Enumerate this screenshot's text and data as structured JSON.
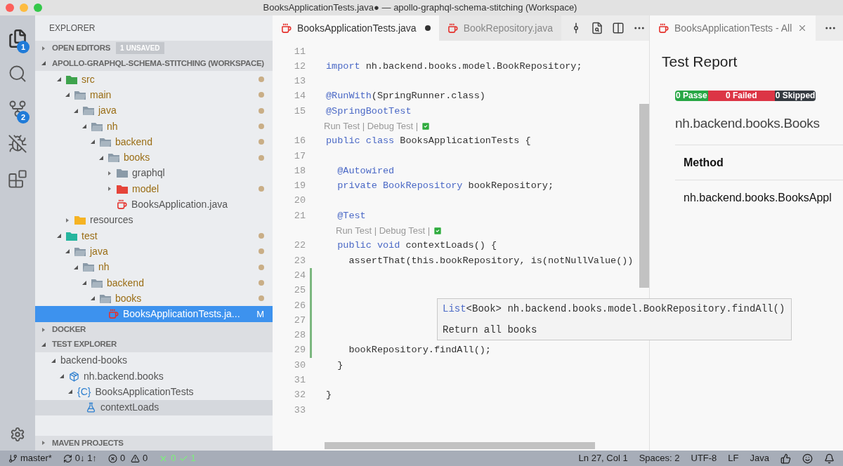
{
  "window": {
    "title": "BooksApplicationTests.java● — apollo-graphql-schema-stitching (Workspace)"
  },
  "activity_bar": {
    "items": [
      {
        "kind": "files",
        "selected": true,
        "badge": "1"
      },
      {
        "kind": "search",
        "selected": false
      },
      {
        "kind": "source-control",
        "selected": false,
        "badge": "2"
      },
      {
        "kind": "debug",
        "selected": false
      },
      {
        "kind": "extensions",
        "selected": false
      }
    ],
    "bottom": {
      "kind": "settings"
    }
  },
  "sidebar": {
    "title": "EXPLORER",
    "open_editors": {
      "label": "OPEN EDITORS",
      "expanded": false,
      "badge": "1 UNSAVED"
    },
    "workspace": {
      "label": "APOLLO-GRAPHQL-SCHEMA-STITCHING (WORKSPACE)",
      "expanded": true,
      "tree": [
        {
          "label": "src",
          "kind": "src-folder",
          "expanded": true,
          "modified": true,
          "children": [
            {
              "label": "main",
              "kind": "folder",
              "expanded": true,
              "modified": true,
              "children": [
                {
                  "label": "java",
                  "kind": "folder",
                  "expanded": true,
                  "modified": true,
                  "children": [
                    {
                      "label": "nh",
                      "kind": "folder",
                      "expanded": true,
                      "modified": true,
                      "children": [
                        {
                          "label": "backend",
                          "kind": "folder",
                          "expanded": true,
                          "modified": true,
                          "children": [
                            {
                              "label": "books",
                              "kind": "folder",
                              "expanded": true,
                              "modified": true,
                              "children": [
                                {
                                  "label": "graphql",
                                  "kind": "folder-closed",
                                  "expanded": false,
                                  "modified": false
                                },
                                {
                                  "label": "model",
                                  "kind": "model-folder",
                                  "expanded": false,
                                  "modified": true
                                },
                                {
                                  "label": "BooksApplication.java",
                                  "kind": "java-file",
                                  "modified": false,
                                  "selected": false
                                }
                              ]
                            }
                          ]
                        }
                      ]
                    }
                  ]
                }
              ]
            },
            {
              "label": "resources",
              "kind": "resources-folder",
              "expanded": false,
              "modified": false
            }
          ]
        },
        {
          "label": "test",
          "kind": "test-folder",
          "expanded": true,
          "modified": true,
          "children": [
            {
              "label": "java",
              "kind": "folder",
              "expanded": true,
              "modified": true,
              "children": [
                {
                  "label": "nh",
                  "kind": "folder",
                  "expanded": true,
                  "modified": true,
                  "children": [
                    {
                      "label": "backend",
                      "kind": "folder",
                      "expanded": true,
                      "modified": true,
                      "children": [
                        {
                          "label": "books",
                          "kind": "folder",
                          "expanded": true,
                          "modified": true,
                          "children": [
                            {
                              "label": "BooksApplicationTests.ja...",
                              "kind": "java-file",
                              "modified": false,
                              "selected": true,
                              "badge": "M"
                            }
                          ]
                        }
                      ]
                    }
                  ]
                }
              ]
            }
          ]
        }
      ]
    },
    "docker": {
      "label": "DOCKER",
      "expanded": false
    },
    "test_explorer": {
      "label": "TEST EXPLORER",
      "expanded": true,
      "tree": [
        {
          "label": "backend-books",
          "kind": "project",
          "expanded": true,
          "selected": false,
          "children": [
            {
              "label": "nh.backend.books",
              "kind": "package",
              "expanded": true,
              "selected": false,
              "children": [
                {
                  "label": "BooksApplicationTests",
                  "kind": "class",
                  "icon_text": "{C}",
                  "expanded": true,
                  "selected": false,
                  "children": [
                    {
                      "label": "contextLoads",
                      "kind": "method",
                      "selected": true
                    }
                  ]
                }
              ]
            }
          ]
        }
      ]
    },
    "maven": {
      "label": "MAVEN PROJECTS",
      "expanded": false
    }
  },
  "editor": {
    "tabs": [
      {
        "label": "BooksApplicationTests.java",
        "selected": true,
        "dirty": true
      },
      {
        "label": "BookRepository.java",
        "selected": false,
        "dirty": false
      }
    ],
    "actions": [
      {
        "kind": "compare"
      },
      {
        "kind": "find"
      },
      {
        "kind": "split"
      },
      {
        "kind": "more"
      }
    ],
    "lines": [
      {
        "number": "11"
      },
      {
        "number": "12",
        "tokens": [
          {
            "kind": "keyword",
            "text": "import"
          },
          {
            "kind": "plain",
            "text": " nh.backend.books.model.BookRepository;"
          }
        ]
      },
      {
        "number": "13"
      },
      {
        "number": "14",
        "tokens": [
          {
            "kind": "annotation",
            "text": "@RunWith"
          },
          {
            "kind": "plain",
            "text": "(SpringRunner.class)"
          }
        ]
      },
      {
        "number": "15",
        "tokens": [
          {
            "kind": "annotation",
            "text": "@SpringBootTest"
          }
        ]
      },
      {
        "kind": "codelens",
        "text": "Run Test | Debug Test |",
        "nested": false
      },
      {
        "number": "16",
        "tokens": [
          {
            "kind": "keyword",
            "text": "public class"
          },
          {
            "kind": "plain",
            "text": " BooksApplicationTests {"
          }
        ]
      },
      {
        "number": "17"
      },
      {
        "number": "18",
        "tokens": [
          {
            "kind": "annotation",
            "text": "  @Autowired"
          }
        ]
      },
      {
        "number": "19",
        "tokens": [
          {
            "kind": "keyword",
            "text": "  private"
          },
          {
            "kind": "type",
            "text": " BookRepository"
          },
          {
            "kind": "plain",
            "text": " bookRepository;"
          }
        ]
      },
      {
        "number": "20"
      },
      {
        "number": "21",
        "tokens": [
          {
            "kind": "annotation",
            "text": "  @Test"
          }
        ]
      },
      {
        "kind": "codelens",
        "text": "Run Test | Debug Test |",
        "nested": true
      },
      {
        "number": "22",
        "tokens": [
          {
            "kind": "keyword",
            "text": "  public void"
          },
          {
            "kind": "plain",
            "text": " contextLoads() {"
          }
        ]
      },
      {
        "number": "23",
        "tokens": [
          {
            "kind": "plain",
            "text": "    assertThat(this.bookRepository, is(notNullValue())"
          }
        ]
      },
      {
        "number": "24",
        "changed": true
      },
      {
        "number": "25",
        "changed": true
      },
      {
        "number": "26",
        "changed": true
      },
      {
        "number": "27",
        "changed": true
      },
      {
        "number": "28",
        "changed": true
      },
      {
        "number": "29",
        "tokens": [
          {
            "kind": "plain",
            "text": "    bookRepository.findAll();"
          }
        ],
        "changed": true
      },
      {
        "number": "30",
        "tokens": [
          {
            "kind": "plain",
            "text": "  }"
          }
        ]
      },
      {
        "number": "31"
      },
      {
        "number": "32",
        "tokens": [
          {
            "kind": "plain",
            "text": "}"
          }
        ]
      },
      {
        "number": "33"
      }
    ],
    "hover": {
      "signature": [
        {
          "kind": "type",
          "text": "List"
        },
        {
          "kind": "plain",
          "text": "<Book> nh.backend.books.model.BookRepository.findAll()"
        }
      ],
      "doc": "Return all books"
    }
  },
  "report_panel": {
    "tab": {
      "label": "BooksApplicationTests - All",
      "selected": true
    },
    "title": "Test Report",
    "summary": [
      {
        "text": "0 Passe",
        "color": "#28a745"
      },
      {
        "text": "0 Failed",
        "color": "#dc3545"
      },
      {
        "text": "0 Skipped",
        "color": "#343a40"
      }
    ],
    "class_name": "nh.backend.books.Books",
    "table": {
      "columns": [
        "Method"
      ],
      "rows": [
        [
          "nh.backend.books.BooksAppl"
        ]
      ]
    }
  },
  "status_bar": {
    "branch": "master*",
    "sync": "0↓ 1↑",
    "errors": "0",
    "warnings": "0",
    "tests_failed": "0",
    "tests_passed": "1",
    "right": [
      "Ln 27, Col 1",
      "Spaces: 2",
      "UTF-8",
      "LF",
      "Java"
    ],
    "icons": [
      {
        "kind": "feedback"
      },
      {
        "kind": "smiley"
      },
      {
        "kind": "bell"
      }
    ]
  }
}
